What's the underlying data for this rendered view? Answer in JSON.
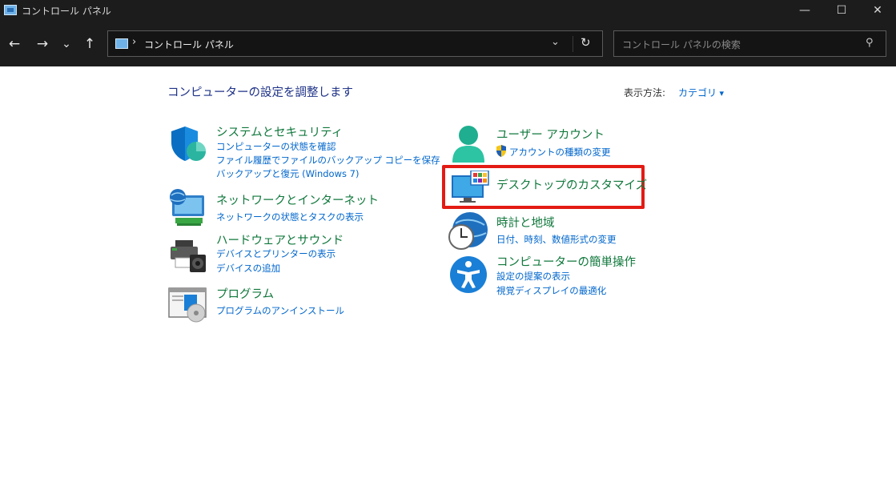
{
  "window": {
    "title": "コントロール パネル",
    "controls": {
      "minimize": "—",
      "maximize": "☐",
      "close": "✕"
    }
  },
  "toolbar": {
    "back": "←",
    "forward": "→",
    "recent": "⌄",
    "up": "↑",
    "breadcrumb_sep": "›",
    "breadcrumb": "コントロール パネル",
    "dropdown": "⌄",
    "refresh": "↻",
    "search_placeholder": "コントロール パネルの検索",
    "search_icon": "⚲"
  },
  "main": {
    "heading": "コンピューターの設定を調整します",
    "view_by_label": "表示方法:",
    "view_by_value": "カテゴリ"
  },
  "categories": {
    "system": {
      "icon": "shield-icon",
      "title": "システムとセキュリティ",
      "links": [
        "コンピューターの状態を確認",
        "ファイル履歴でファイルのバックアップ コピーを保存",
        "バックアップと復元 (Windows 7)"
      ]
    },
    "network": {
      "icon": "network-globe-icon",
      "title": "ネットワークとインターネット",
      "links": [
        "ネットワークの状態とタスクの表示"
      ]
    },
    "hardware": {
      "icon": "printer-icon",
      "title": "ハードウェアとサウンド",
      "links": [
        "デバイスとプリンターの表示",
        "デバイスの追加"
      ]
    },
    "programs": {
      "icon": "programs-icon",
      "title": "プログラム",
      "links": [
        "プログラムのアンインストール"
      ]
    },
    "user": {
      "icon": "user-icon",
      "title": "ユーザー アカウント",
      "links": [
        "アカウントの種類の変更"
      ]
    },
    "desktop": {
      "icon": "monitor-icon",
      "title": "デスクトップのカスタマイズ",
      "links": []
    },
    "clock": {
      "icon": "clock-globe-icon",
      "title": "時計と地域",
      "links": [
        "日付、時刻、数値形式の変更"
      ]
    },
    "access": {
      "icon": "accessibility-icon",
      "title": "コンピューターの簡単操作",
      "links": [
        "設定の提案の表示",
        "視覚ディスプレイの最適化"
      ]
    }
  },
  "colors": {
    "category_title": "#10783c",
    "link": "#0066cc",
    "highlight": "#e31b14",
    "chrome": "#1c1c1c"
  }
}
